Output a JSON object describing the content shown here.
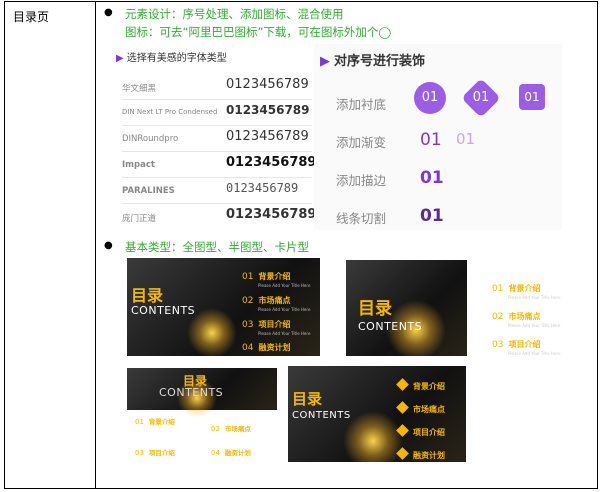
{
  "left_label": "目录页",
  "bullets": [
    "●",
    "●"
  ],
  "line1": "元素设计：序号处理、添加图标、混合使用",
  "line2": "图标：可去“阿里巴巴图标”下载，可在图标外加个◯",
  "line3": "基本类型：全图型、半图型、卡片型",
  "font_panel": {
    "title": "选择有美感的字体类型",
    "rows": [
      {
        "name": "华文细黑",
        "sample": "0123456789"
      },
      {
        "name": "DIN Next LT Pro Condensed",
        "sample": "0123456789"
      },
      {
        "name": "DINRoundpro",
        "sample": "0123456789"
      },
      {
        "name": "Impact",
        "sample": "0123456789"
      },
      {
        "name": "PARALINES",
        "sample": "0123456789"
      },
      {
        "name": "庞门正道",
        "sample": "0123456789"
      }
    ]
  },
  "deco_panel": {
    "title": "对序号进行装饰",
    "labels": [
      "添加衬底",
      "添加渐变",
      "添加描边",
      "线条切割"
    ],
    "nums": [
      "01",
      "01",
      "01",
      "01",
      "01",
      "01",
      "01"
    ]
  },
  "thumbs": {
    "mulu": "目录",
    "contents": "CONTENTS",
    "items": [
      {
        "n": "01",
        "t": "背景介绍"
      },
      {
        "n": "02",
        "t": "市场痛点"
      },
      {
        "n": "03",
        "t": "项目介绍"
      },
      {
        "n": "04",
        "t": "融资计划"
      }
    ],
    "sub": "Please Add Your Title Here"
  },
  "colors": {
    "accent_purple": "#7a39d6",
    "accent_yellow": "#f5b800",
    "green_text": "#2fb02f"
  }
}
